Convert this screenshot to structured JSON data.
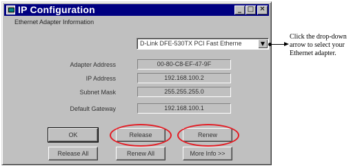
{
  "window": {
    "title": "IP Configuration",
    "subtitle": "Ethernet Adapter Information"
  },
  "adapter_select": {
    "selected": "D-Link DFE-530TX PCI Fast Etherne"
  },
  "fields": [
    {
      "label": "Adapter Address",
      "value": "00-80-C8-EF-47-9F"
    },
    {
      "label": "IP Address",
      "value": "192.168.100.2"
    },
    {
      "label": "Subnet Mask",
      "value": "255.255.255.0"
    },
    {
      "label": "Default Gateway",
      "value": "192.168.100.1"
    }
  ],
  "buttons": {
    "ok": "OK",
    "release": "Release",
    "renew": "Renew",
    "release_all": "Release All",
    "renew_all": "Renew All",
    "more_info": "More Info >>"
  },
  "callout": {
    "text": "Click the drop-down arrow to select your Ethernet adapter."
  },
  "icons": {
    "app": "network-icon",
    "minimize": "minimize-icon",
    "maximize": "maximize-icon",
    "close": "close-icon",
    "dropdown": "chevron-down-icon"
  },
  "colors": {
    "titlebar": "#000080",
    "highlight_ring": "#e41b23"
  }
}
